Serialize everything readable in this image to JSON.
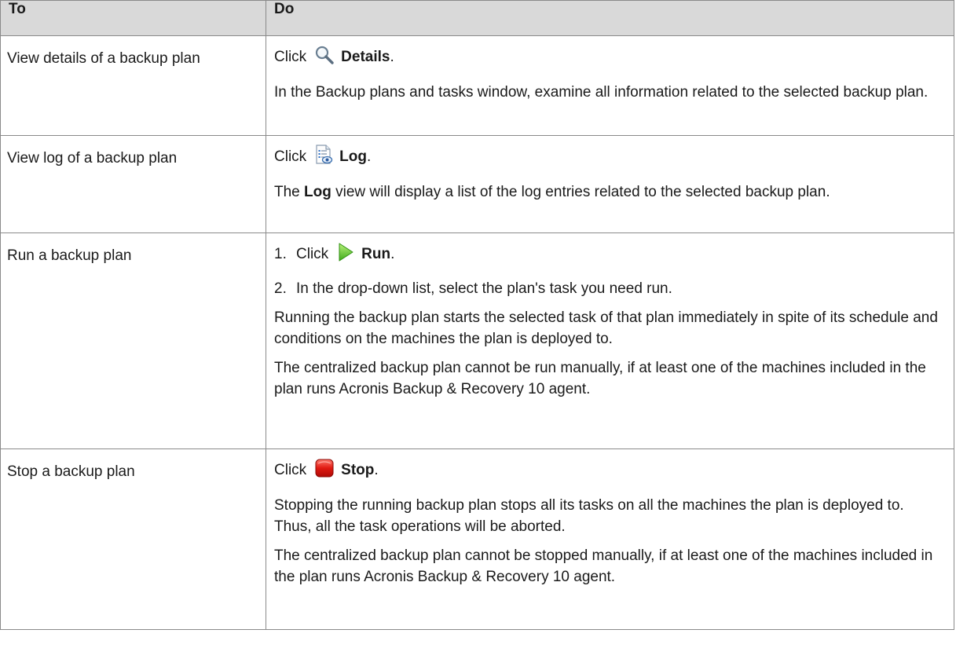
{
  "table": {
    "headers": {
      "to": "To",
      "do": "Do"
    },
    "rows": [
      {
        "to": "View details of a backup plan",
        "action_prefix": "Click",
        "icon": "magnifier-icon",
        "action_label": "Details",
        "action_suffix": ".",
        "paragraphs": [
          "In the Backup plans and tasks window, examine all information related to the selected backup plan."
        ]
      },
      {
        "to": "View log of a backup plan",
        "action_prefix": "Click",
        "icon": "log-document-icon",
        "action_label": "Log",
        "action_suffix": ".",
        "para_bold": "Log",
        "para_rest": " view will display a list of the log entries related to the selected backup plan.",
        "para_prefix": "The"
      },
      {
        "to": "Run a backup plan",
        "step1_num": "1.",
        "action_prefix": "Click",
        "icon": "play-icon",
        "action_label": "Run",
        "action_suffix": ".",
        "step2_num": "2.",
        "step2_text": "In the drop-down list, select the plan's task you need run.",
        "paragraphs": [
          "Running the backup plan starts the selected task of that plan immediately in spite of its schedule and conditions on the machines the plan is deployed to.",
          "The centralized backup plan cannot be run manually, if at least one of the machines included in the plan runs Acronis Backup & Recovery 10 agent."
        ]
      },
      {
        "to": "Stop a backup plan",
        "action_prefix": "Click",
        "icon": "stop-icon",
        "action_label": "Stop",
        "action_suffix": ".",
        "paragraphs": [
          "Stopping the running backup plan stops all its tasks on all the machines the plan is deployed to. Thus, all the task operations will be aborted.",
          "The centralized backup plan cannot be stopped manually, if at least one of the machines included in the plan runs Acronis Backup & Recovery 10 agent."
        ]
      }
    ]
  }
}
